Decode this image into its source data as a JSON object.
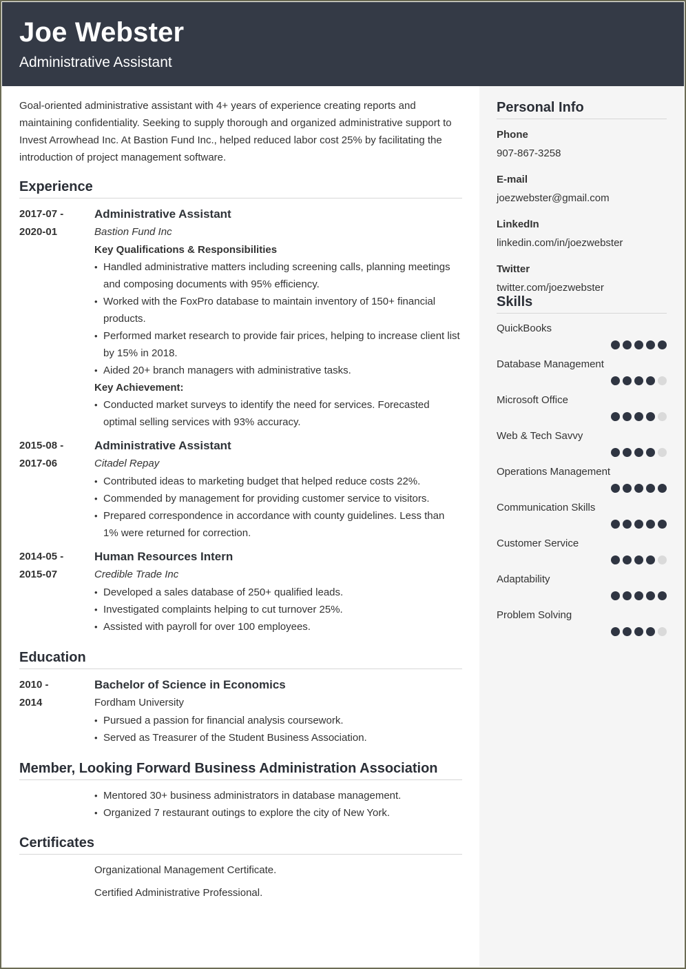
{
  "header": {
    "name": "Joe Webster",
    "role": "Administrative Assistant"
  },
  "summary": "Goal-oriented administrative assistant with 4+ years of experience creating reports and maintaining confidentiality. Seeking to supply thorough and organized administrative support to Invest Arrowhead Inc. At Bastion Fund Inc., helped reduced labor cost 25% by facilitating the introduction of project management software.",
  "experience": {
    "title": "Experience",
    "items": [
      {
        "date_start": "2017-07 -",
        "date_end": "2020-01",
        "title": "Administrative Assistant",
        "company": "Bastion Fund Inc",
        "subhead1": "Key Qualifications & Responsibilities",
        "bullets1": [
          "Handled administrative matters including screening calls, planning meetings and composing documents with 95% efficiency.",
          "Worked with the FoxPro database to maintain inventory of 150+ financial products.",
          "Performed market research to provide fair prices, helping to increase client list by 15% in 2018.",
          "Aided 20+ branch managers with administrative tasks."
        ],
        "subhead2": "Key Achievement:",
        "bullets2": [
          "Conducted market surveys to identify the need for services. Forecasted optimal selling services with 93% accuracy."
        ]
      },
      {
        "date_start": "2015-08 -",
        "date_end": "2017-06",
        "title": "Administrative Assistant",
        "company": "Citadel Repay",
        "bullets": [
          "Contributed ideas to marketing budget that helped reduce costs 22%.",
          "Commended by management for providing customer service to visitors.",
          "Prepared correspondence in accordance with county guidelines. Less than 1% were returned for correction."
        ]
      },
      {
        "date_start": "2014-05 -",
        "date_end": "2015-07",
        "title": "Human Resources Intern",
        "company": "Credible Trade Inc",
        "bullets": [
          "Developed a sales database of 250+ qualified leads.",
          "Investigated complaints helping to cut turnover 25%.",
          "Assisted with payroll for over 100 employees."
        ]
      }
    ]
  },
  "education": {
    "title": "Education",
    "date_start": "2010 -",
    "date_end": "2014",
    "degree": "Bachelor of Science in Economics",
    "school": "Fordham University",
    "bullets": [
      "Pursued a passion for financial analysis coursework.",
      "Served as Treasurer of the Student Business Association."
    ]
  },
  "membership": {
    "title": "Member, Looking Forward Business Administration Association",
    "bullets": [
      "Mentored 30+ business administrators in database management.",
      "Organized 7 restaurant outings to explore the city of New York."
    ]
  },
  "certificates": {
    "title": "Certificates",
    "items": [
      "Organizational Management Certificate.",
      "Certified Administrative Professional."
    ]
  },
  "personal_info": {
    "title": "Personal Info",
    "fields": [
      {
        "label": "Phone",
        "value": "907-867-3258"
      },
      {
        "label": "E-mail",
        "value": "joezwebster@gmail.com"
      },
      {
        "label": "LinkedIn",
        "value": "linkedin.com/in/joezwebster"
      },
      {
        "label": "Twitter",
        "value": "twitter.com/joezwebster"
      }
    ]
  },
  "skills": {
    "title": "Skills",
    "max_level": 5,
    "items": [
      {
        "name": "QuickBooks",
        "level": 5
      },
      {
        "name": "Database Management",
        "level": 4
      },
      {
        "name": "Microsoft Office",
        "level": 4
      },
      {
        "name": "Web & Tech Savvy",
        "level": 4
      },
      {
        "name": "Operations Management",
        "level": 5
      },
      {
        "name": "Communication Skills",
        "level": 5
      },
      {
        "name": "Customer Service",
        "level": 4
      },
      {
        "name": "Adaptability",
        "level": 5
      },
      {
        "name": "Problem Solving",
        "level": 4
      }
    ]
  },
  "colors": {
    "header_bg": "#343a46",
    "sidebar_bg": "#f5f5f5",
    "dot_filled": "#2f3542",
    "dot_empty": "#dadada"
  }
}
